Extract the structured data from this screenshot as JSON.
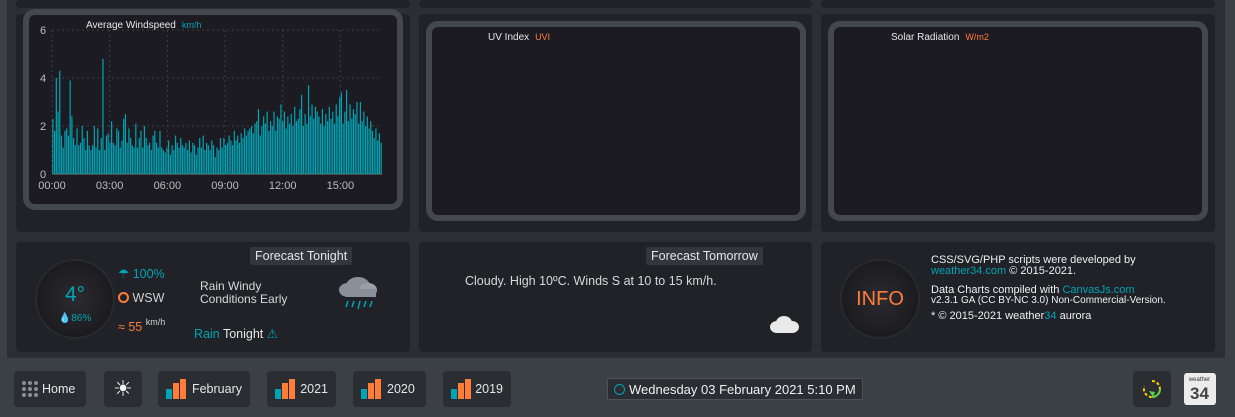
{
  "colors": {
    "teal": "#00a4b4",
    "orange": "#ff7c39",
    "bar": "#00a4b4"
  },
  "wind_chart": {
    "title": "Average Windspeed",
    "unit": "km/h",
    "y_ticks": [
      "0",
      "2",
      "4",
      "6"
    ],
    "x_ticks": [
      "00:00",
      "03:00",
      "06:00",
      "09:00",
      "12:00",
      "15:00"
    ]
  },
  "uv_chart": {
    "title": "UV Index",
    "unit": "UVI"
  },
  "solar_chart": {
    "title": "Solar Radiation",
    "unit": "W/m2"
  },
  "chart_data": [
    {
      "type": "bar",
      "title": "Average Windspeed",
      "unit": "km/h",
      "ylim": [
        0,
        6
      ],
      "x_range": [
        "00:00",
        "17:10"
      ],
      "series": [
        {
          "values": [
            2.3,
            1.8,
            4.0,
            2.6,
            4.3,
            1.6,
            1.1,
            1.8,
            1.9,
            1.6,
            3.9,
            2.4,
            1.5,
            1.2,
            1.9,
            1.2,
            1.3,
            2.0,
            1.5,
            1.0,
            1.8,
            1.2,
            1.0,
            1.2,
            2.0,
            1.1,
            1.9,
            1.0,
            1.5,
            4.8,
            1.0,
            1.6,
            1.7,
            1.3,
            2.2,
            1.3,
            1.2,
            1.9,
            1.8,
            1.1,
            1.4,
            2.3,
            2.5,
            1.3,
            1.9,
            1.5,
            1.2,
            1.1,
            2.1,
            1.1,
            1.5,
            1.8,
            1.1,
            2.0,
            1.5,
            1.2,
            1.3,
            1.0,
            1.6,
            1.8,
            1.3,
            1.1,
            1.8,
            1.1,
            1.0,
            0.9,
            1.1,
            1.4,
            0.8,
            1.2,
            1.0,
            1.6,
            1.3,
            1.1,
            1.5,
            1.2,
            1.1,
            1.3,
            1.0,
            1.4,
            0.9,
            1.3,
            1.2,
            0.8,
            1.1,
            1.5,
            1.1,
            1.6,
            1.0,
            1.3,
            1.2,
            1.0,
            1.4,
            1.2,
            0.7,
            1.1,
            1.0,
            1.5,
            1.1,
            1.5,
            1.2,
            1.3,
            1.6,
            1.4,
            1.2,
            1.8,
            1.4,
            1.6,
            1.3,
            1.7,
            1.5,
            1.9,
            1.6,
            1.8,
            1.9,
            2.0,
            1.7,
            2.1,
            2.2,
            2.7,
            1.6,
            2.0,
            2.4,
            2.1,
            2.6,
            1.8,
            2.2,
            2.0,
            2.6,
            1.8,
            2.4,
            2.3,
            2.9,
            2.2,
            2.6,
            1.9,
            2.4,
            2.1,
            2.5,
            2.0,
            2.8,
            2.2,
            2.3,
            2.7,
            3.3,
            2.0,
            2.5,
            2.1,
            3.7,
            2.4,
            2.9,
            2.3,
            2.8,
            2.6,
            2.4,
            2.1,
            2.7,
            2.0,
            2.5,
            2.2,
            2.8,
            2.3,
            2.6,
            2.1,
            2.9,
            2.4,
            3.2,
            3.4,
            2.1,
            2.6,
            3.5,
            2.2,
            2.9,
            2.3,
            2.7,
            2.5,
            3.0,
            2.1,
            3.0,
            2.2,
            2.6,
            2.0,
            2.4,
            1.9,
            2.2,
            1.8,
            1.5,
            1.9,
            1.4,
            1.7,
            1.3
          ]
        }
      ]
    },
    {
      "type": "bar",
      "title": "UV Index",
      "unit": "UVI",
      "series": []
    },
    {
      "type": "bar",
      "title": "Solar Radiation",
      "unit": "W/m2",
      "series": []
    }
  ],
  "tonight": {
    "header": "Forecast Tonight",
    "temperature": "4°",
    "dew": "86%",
    "humidity": "100%",
    "wind_dir": "WSW",
    "wind_speed": "55",
    "wind_unit": "km/h",
    "summary_line1": "Rain Windy",
    "summary_line2": "Conditions Early",
    "alert_word": "Rain",
    "alert_rest": " Tonight",
    "icon": "rain-cloud-icon"
  },
  "tomorrow": {
    "header": "Forecast Tomorrow",
    "text": "Cloudy. High 10ºC. Winds S at 10 to 15 km/h.",
    "icon": "cloud-icon"
  },
  "info": {
    "badge": "INFO",
    "line1": "CSS/SVG/PHP scripts were developed by",
    "link1": "weather34.com",
    "line1b": " © 2015-2021.",
    "line2a": "Data Charts compiled with ",
    "link2": "CanvasJs.com",
    "line2b": "v2.3.1 GA (CC BY-NC 3.0) Non-Commercial-Version.",
    "line3a": "* © 2015-2021 weather",
    "line3num": "34",
    "line3b": " aurora"
  },
  "toolbar": {
    "home_label": "Home",
    "month_label": "February",
    "year1_label": "2021",
    "year2_label": "2020",
    "year3_label": "2019",
    "datetime": "Wednesday 03 February 2021 5:10 PM",
    "logo_top": "weather",
    "logo_num": "34"
  }
}
